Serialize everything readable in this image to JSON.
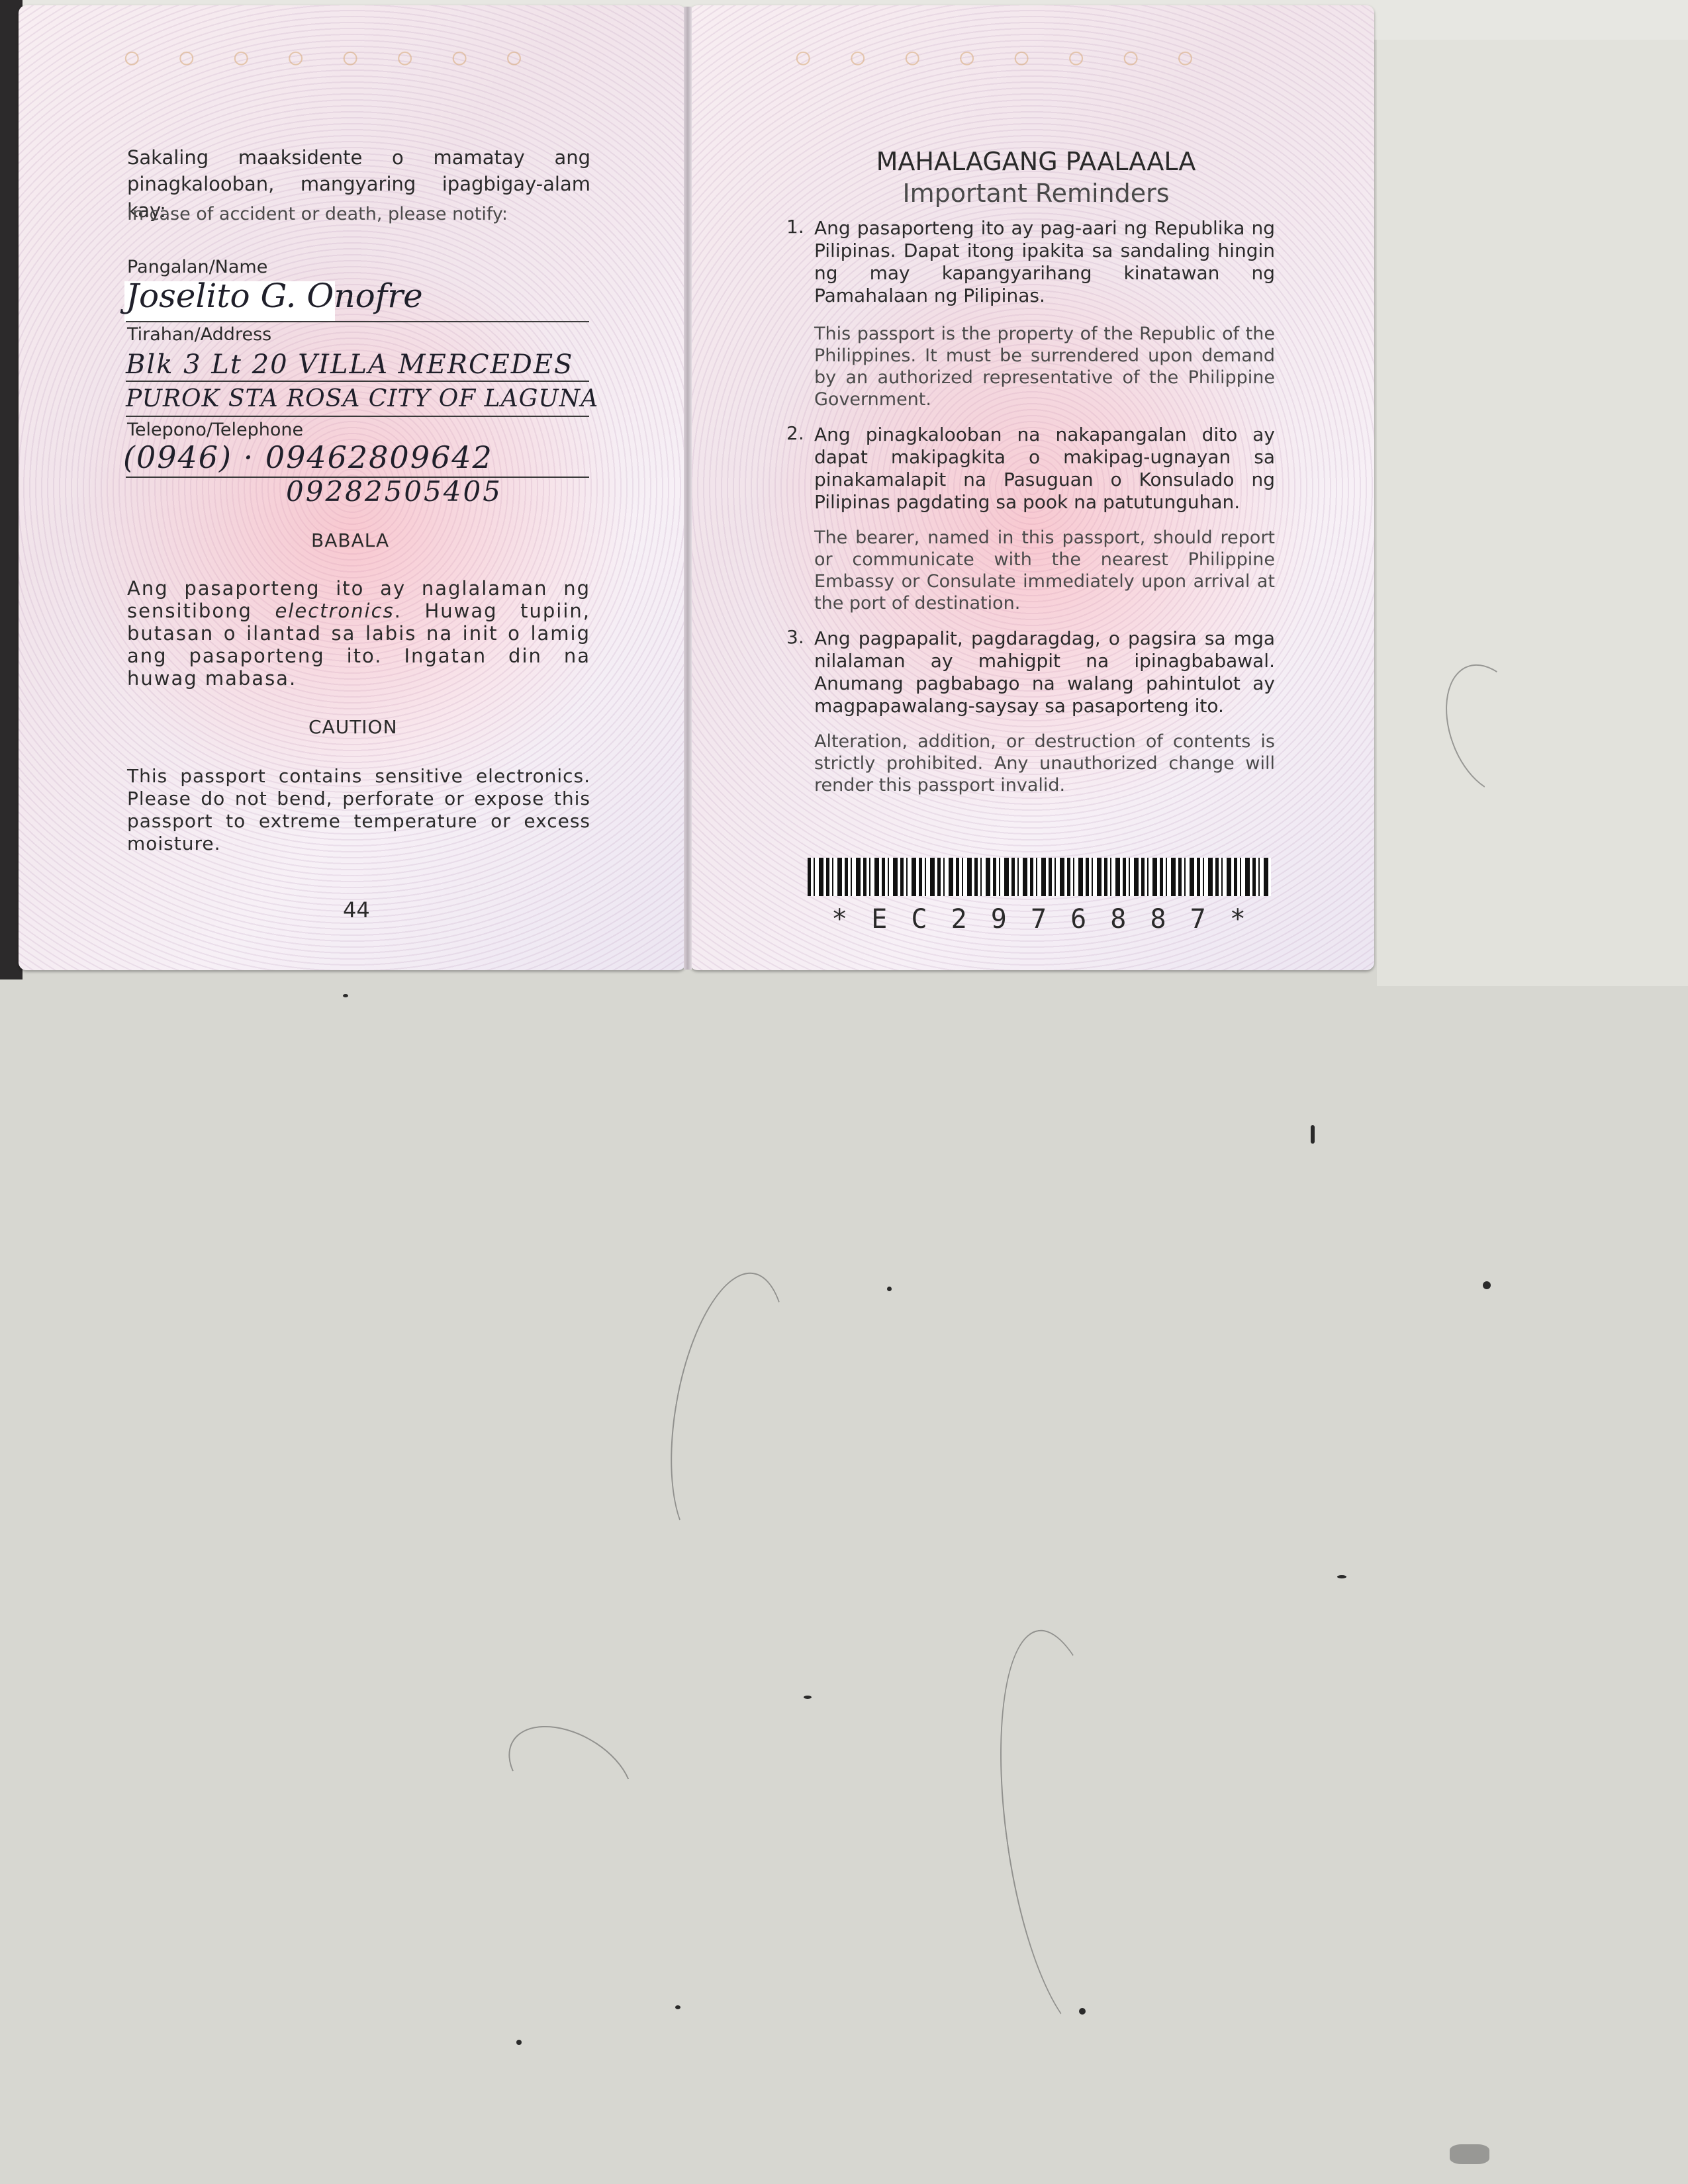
{
  "left_page": {
    "notify_tl": "Sakaling maaksidente o mamatay ang pinagkalooban, mangyaring ipagbigay-alam kay:",
    "notify_en": "In case of accident or death, please notify:",
    "name_label": "Pangalan/Name",
    "name_value": "Joselito G. Onofre",
    "address_label": "Tirahan/Address",
    "address_line1": "Blk 3 Lt 20 VILLA MERCEDES",
    "address_line2": "PUROK STA ROSA CITY OF LAGUNA",
    "phone_label": "Telepono/Telephone",
    "phone_line1": "(0946) · 09462809642",
    "phone_line2": "09282505405",
    "warning_title_tl": "BABALA",
    "warning_text_tl_1": "Ang pasaporteng ito ay naglalaman ng",
    "warning_text_tl_2_pre": "sensitibong",
    "warning_text_tl_2_em": "electronics",
    "warning_text_tl_2_post": ". Huwag tupiin,",
    "warning_text_tl_3": "butasan o ilantad sa labis na init o lamig",
    "warning_text_tl_4": "ang pasaporteng ito. Ingatan din na",
    "warning_text_tl_5": "huwag mabasa.",
    "warning_title_en": "CAUTION",
    "warning_text_en": "This passport contains sensitive electronics. Please do not bend, perforate or expose this passport to extreme temperature or excess moisture.",
    "page_number": "44"
  },
  "right_page": {
    "title_tl": "MAHALAGANG PAALAALA",
    "title_en": "Important Reminders",
    "reminders": [
      {
        "num": "1.",
        "tl": "Ang pasaporteng ito ay pag-aari ng Republika ng Pilipinas. Dapat itong ipakita sa sandaling hingin ng may kapangyarihang kinatawan ng Pamahalaan ng Pilipinas.",
        "en": "This passport is the property of the Republic of the Philippines. It must be surrendered upon demand by an authorized representative of the Philippine Government."
      },
      {
        "num": "2.",
        "tl": "Ang pinagkalooban na nakapangalan dito ay dapat makipagkita o makipag-ugnayan sa pinakamalapit na Pasuguan o Konsulado ng Pilipinas pagdating sa pook na patutunguhan.",
        "en": "The bearer, named in this passport, should report or communicate with the nearest Philippine Embassy or Consulate immediately upon arrival at the port of destination."
      },
      {
        "num": "3.",
        "tl": "Ang pagpapalit, pagdaragdag, o pagsira sa mga nilalaman ay mahigpit na ipinagbabawal. Anumang pagbabago na walang pahintulot ay magpapawalang-saysay sa pasaporteng ito.",
        "en": "Alteration, addition, or destruction of contents is strictly prohibited. Any unauthorized change will render this passport invalid."
      }
    ],
    "barcode_text": "* E C 2 9 7 6 8 8 7 *"
  }
}
